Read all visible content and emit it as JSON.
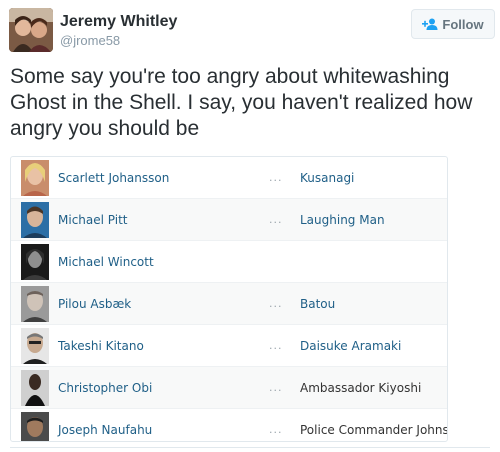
{
  "tweet": {
    "author_name": "Jeremy Whitley",
    "author_handle": "@jrome58",
    "follow_label": "Follow",
    "text": "Some say you're too angry about whitewashing Ghost in the Shell. I say, you haven't realized how angry you should be"
  },
  "cast": [
    {
      "actor": "Scarlett Johansson",
      "dots": "...",
      "role": "Kusanagi",
      "role_link": true
    },
    {
      "actor": "Michael Pitt",
      "dots": "...",
      "role": "Laughing Man",
      "role_link": true
    },
    {
      "actor": "Michael Wincott",
      "dots": "",
      "role": "",
      "role_link": false
    },
    {
      "actor": "Pilou Asbæk",
      "dots": "...",
      "role": "Batou",
      "role_link": true
    },
    {
      "actor": "Takeshi Kitano",
      "dots": "...",
      "role": "Daisuke Aramaki",
      "role_link": true
    },
    {
      "actor": "Christopher Obi",
      "dots": "...",
      "role": "Ambassador Kiyoshi",
      "role_link": false
    },
    {
      "actor": "Joseph Naufahu",
      "dots": "...",
      "role": "Police Commander Johns",
      "role_link": false
    }
  ],
  "colors": {
    "link": "#1f5f87",
    "text": "#292f33",
    "muted": "#8899a6",
    "twitter_blue": "#1da1f2"
  }
}
